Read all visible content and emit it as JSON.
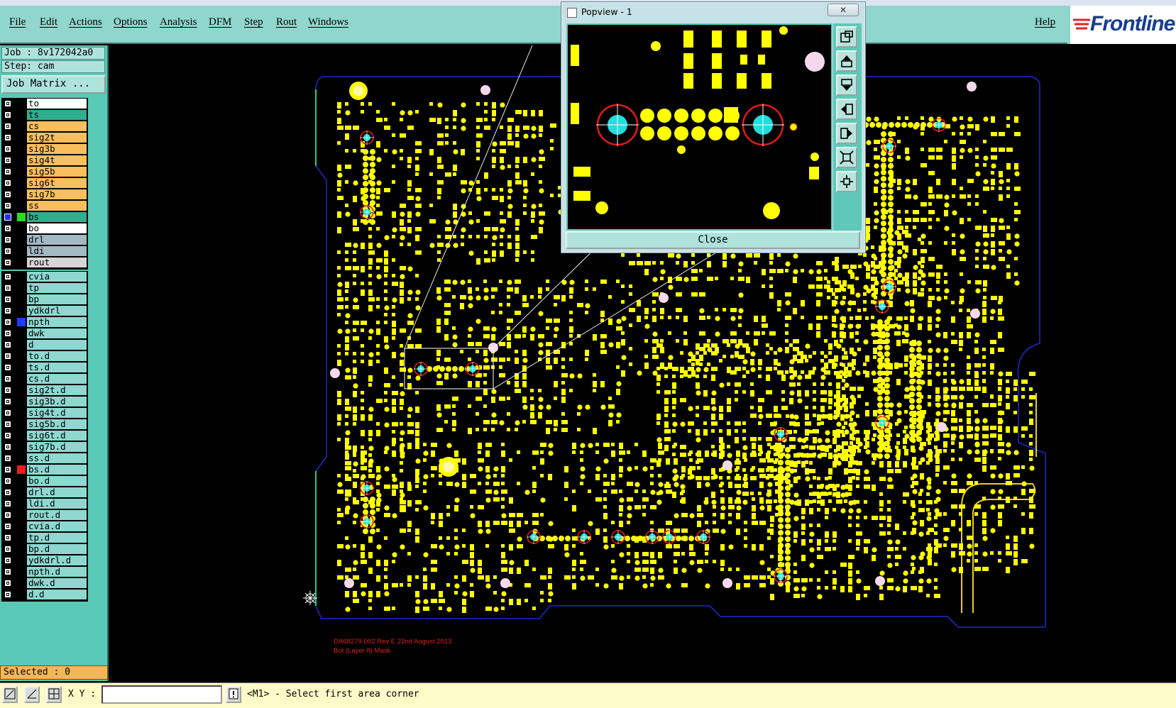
{
  "menu": {
    "items": [
      "File",
      "Edit",
      "Actions",
      "Options",
      "Analysis",
      "DFM",
      "Step",
      "Rout",
      "Windows"
    ],
    "help": "Help",
    "logo": "Frontline"
  },
  "job": {
    "job_line": "Job : 8v172042a0",
    "step_line": "Step: cam",
    "matrix_button": "Job Matrix ..."
  },
  "layers": {
    "board": [
      {
        "name": "to",
        "color": "#ffffff",
        "checked": false
      },
      {
        "name": "ts",
        "color": "#2fae8e",
        "checked": false
      },
      {
        "name": "cs",
        "color": "#f9bf5e",
        "checked": false
      },
      {
        "name": "sig2t",
        "color": "#f9bf5e",
        "checked": false
      },
      {
        "name": "sig3b",
        "color": "#f9bf5e",
        "checked": false
      },
      {
        "name": "sig4t",
        "color": "#f9bf5e",
        "checked": false
      },
      {
        "name": "sig5b",
        "color": "#f9bf5e",
        "checked": false
      },
      {
        "name": "sig6t",
        "color": "#f9bf5e",
        "checked": false
      },
      {
        "name": "sig7b",
        "color": "#f9bf5e",
        "checked": false
      },
      {
        "name": "ss",
        "color": "#f9bf5e",
        "checked": false
      },
      {
        "name": "bs",
        "color": "#2fae8e",
        "checked": true,
        "display": "#22dd22"
      },
      {
        "name": "bo",
        "color": "#ffffff",
        "checked": false
      }
    ],
    "drill": [
      {
        "name": "drl",
        "color": "#a3b9c4",
        "checked": false
      },
      {
        "name": "ldi",
        "color": "#a3b9c4",
        "checked": false
      },
      {
        "name": "rout",
        "color": "#d6d6d6",
        "checked": false
      }
    ],
    "misc": [
      {
        "name": "cvia",
        "color": "#8ed8d0",
        "checked": false
      },
      {
        "name": "tp",
        "color": "#8ed8d0",
        "checked": false
      },
      {
        "name": "bp",
        "color": "#8ed8d0",
        "checked": false
      },
      {
        "name": "ydkdrl",
        "color": "#8ed8d0",
        "checked": false
      },
      {
        "name": "npth",
        "color": "#8ed8d0",
        "checked": false,
        "display": "#1c3cff"
      },
      {
        "name": "dwk",
        "color": "#8ed8d0",
        "checked": false
      },
      {
        "name": "d",
        "color": "#8ed8d0",
        "checked": false
      },
      {
        "name": "to.d",
        "color": "#8ed8d0",
        "checked": false
      },
      {
        "name": "ts.d",
        "color": "#8ed8d0",
        "checked": false
      },
      {
        "name": "cs.d",
        "color": "#8ed8d0",
        "checked": false
      },
      {
        "name": "sig2t.d",
        "color": "#8ed8d0",
        "checked": false
      },
      {
        "name": "sig3b.d",
        "color": "#8ed8d0",
        "checked": false
      },
      {
        "name": "sig4t.d",
        "color": "#8ed8d0",
        "checked": false
      },
      {
        "name": "sig5b.d",
        "color": "#8ed8d0",
        "checked": false
      },
      {
        "name": "sig6t.d",
        "color": "#8ed8d0",
        "checked": false
      },
      {
        "name": "sig7b.d",
        "color": "#8ed8d0",
        "checked": false
      },
      {
        "name": "ss.d",
        "color": "#8ed8d0",
        "checked": false
      },
      {
        "name": "bs.d",
        "color": "#8ed8d0",
        "checked": false,
        "display": "#ee1c1c"
      },
      {
        "name": "bo.d",
        "color": "#8ed8d0",
        "checked": false
      },
      {
        "name": "drl.d",
        "color": "#8ed8d0",
        "checked": false
      },
      {
        "name": "ldi.d",
        "color": "#8ed8d0",
        "checked": false
      },
      {
        "name": "rout.d",
        "color": "#8ed8d0",
        "checked": false
      },
      {
        "name": "cvia.d",
        "color": "#8ed8d0",
        "checked": false
      },
      {
        "name": "tp.d",
        "color": "#8ed8d0",
        "checked": false
      },
      {
        "name": "bp.d",
        "color": "#8ed8d0",
        "checked": false
      },
      {
        "name": "ydkdrl.d",
        "color": "#8ed8d0",
        "checked": false
      },
      {
        "name": "npth.d",
        "color": "#8ed8d0",
        "checked": false
      },
      {
        "name": "dwk.d",
        "color": "#8ed8d0",
        "checked": false
      },
      {
        "name": "d.d",
        "color": "#8ed8d0",
        "checked": false
      }
    ]
  },
  "status": {
    "selected": "Selected : 0",
    "xy_label": "X Y :",
    "xy_value": "",
    "prompt": "<M1> - Select first area corner"
  },
  "popview": {
    "title": "Popview - 1",
    "close_x": "✕",
    "close_button": "Close"
  },
  "pcb_text": {
    "line1": "DA68279-002 Rev E   22nd August 2013",
    "line2": "Bot (Layer 8) Mask"
  },
  "colors": {
    "pad": "#ffff00",
    "outline": "#1c2bd0",
    "fiducial": "#e81818",
    "hole": "#22dede",
    "npth_hole": "#f6d8ec",
    "panel": "#5ac9b7"
  }
}
